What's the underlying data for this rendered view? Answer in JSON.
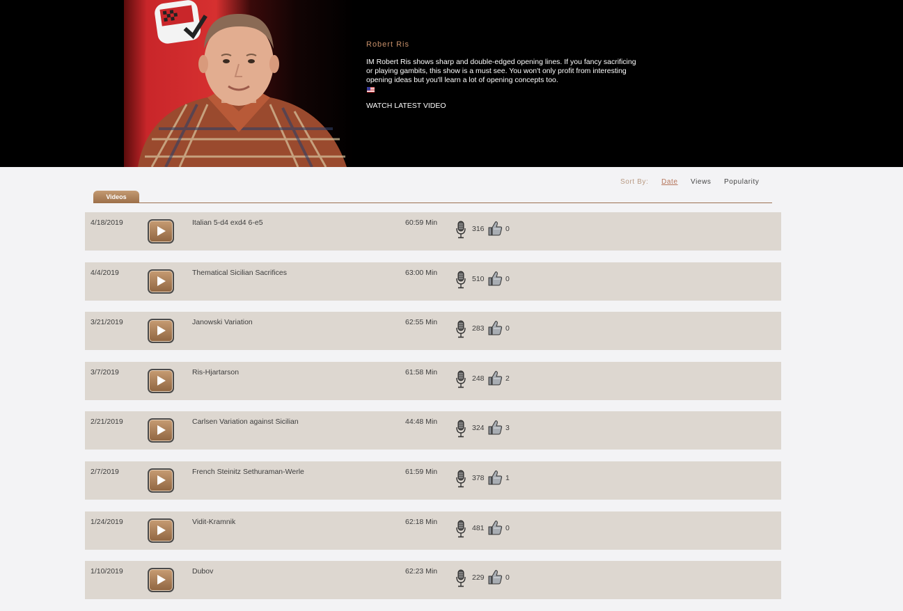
{
  "header": {
    "host_name": "Robert Ris",
    "description": "IM Robert Ris shows sharp and double-edged opening lines. If you fancy sacrificing or playing gambits, this show is a must see. You won't only profit from interesting opening ideas but you'll learn a lot of opening concepts too.",
    "flag_icon": "us-flag-icon",
    "watch_latest_label": "WATCH LATEST VIDEO"
  },
  "sort": {
    "label": "Sort By:",
    "options": [
      "Date",
      "Views",
      "Popularity"
    ],
    "active": "Date"
  },
  "tabs": [
    {
      "label": "Videos",
      "active": true
    }
  ],
  "colors": {
    "accent": "#b4745a",
    "tab_bg": "#b08560",
    "row_bg": "#ddd7d0",
    "banner_bg": "#000000"
  },
  "videos": [
    {
      "date": "4/18/2019",
      "title": "Italian 5-d4 exd4 6-e5",
      "duration": "60:59 Min",
      "views": "316",
      "likes": "0"
    },
    {
      "date": "4/4/2019",
      "title": "Thematical Sicilian Sacrifices",
      "duration": "63:00 Min",
      "views": "510",
      "likes": "0"
    },
    {
      "date": "3/21/2019",
      "title": "Janowski Variation",
      "duration": "62:55 Min",
      "views": "283",
      "likes": "0"
    },
    {
      "date": "3/7/2019",
      "title": "Ris-Hjartarson",
      "duration": "61:58 Min",
      "views": "248",
      "likes": "2"
    },
    {
      "date": "2/21/2019",
      "title": "Carlsen Variation against Sicilian",
      "duration": "44:48 Min",
      "views": "324",
      "likes": "3"
    },
    {
      "date": "2/7/2019",
      "title": "French Steinitz Sethuraman-Werle",
      "duration": "61:59 Min",
      "views": "378",
      "likes": "1"
    },
    {
      "date": "1/24/2019",
      "title": "Vidit-Kramnik",
      "duration": "62:18 Min",
      "views": "481",
      "likes": "0"
    },
    {
      "date": "1/10/2019",
      "title": "Dubov",
      "duration": "62:23 Min",
      "views": "229",
      "likes": "0"
    }
  ]
}
